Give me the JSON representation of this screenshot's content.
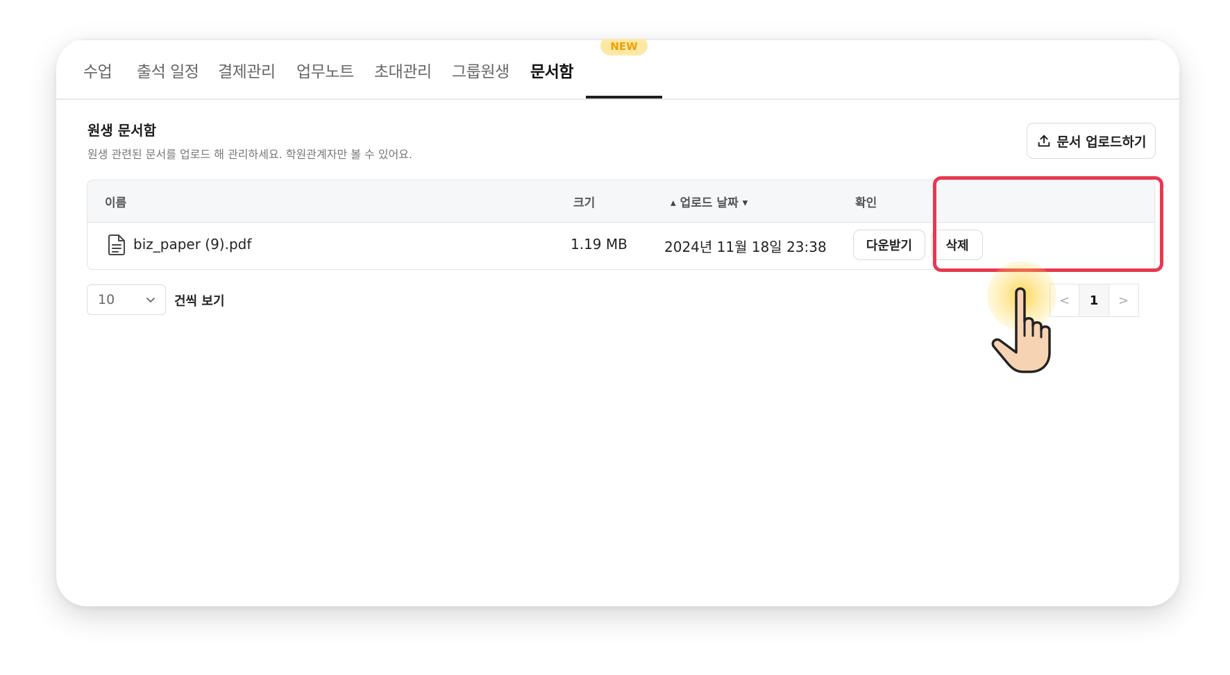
{
  "tabs": [
    {
      "label": "수업"
    },
    {
      "label": "출석 일정"
    },
    {
      "label": "결제관리"
    },
    {
      "label": "업무노트"
    },
    {
      "label": "초대관리"
    },
    {
      "label": "그룹원생"
    },
    {
      "label": "문서함",
      "active": true,
      "badge": "NEW"
    }
  ],
  "section": {
    "title": "원생 문서함",
    "description": "원생 관련된 문서를 업로드 해 관리하세요. 학원관계자만 볼 수 있어요.",
    "upload_label": "문서 업로드하기"
  },
  "table": {
    "headers": {
      "name": "이름",
      "size": "크기",
      "date": "업로드 날짜",
      "actions": "확인"
    },
    "rows": [
      {
        "name": "biz_paper (9).pdf",
        "size": "1.19 MB",
        "date": "2024년 11월 18일 23:38",
        "download_label": "다운받기",
        "delete_label": "삭제"
      }
    ]
  },
  "pagination": {
    "page_size": "10",
    "page_size_suffix": "건씩 보기",
    "prev": "<",
    "current_page": "1",
    "next": ">"
  },
  "colors": {
    "highlight": "#e8384f",
    "badge_bg": "#fde8a6",
    "badge_text": "#f0a000",
    "tap_glow": "#ffc81e"
  },
  "icons": {
    "upload": "upload-icon",
    "file": "document-icon",
    "dropdown": "chevron-down-icon",
    "pointer": "pointing-hand-icon"
  }
}
